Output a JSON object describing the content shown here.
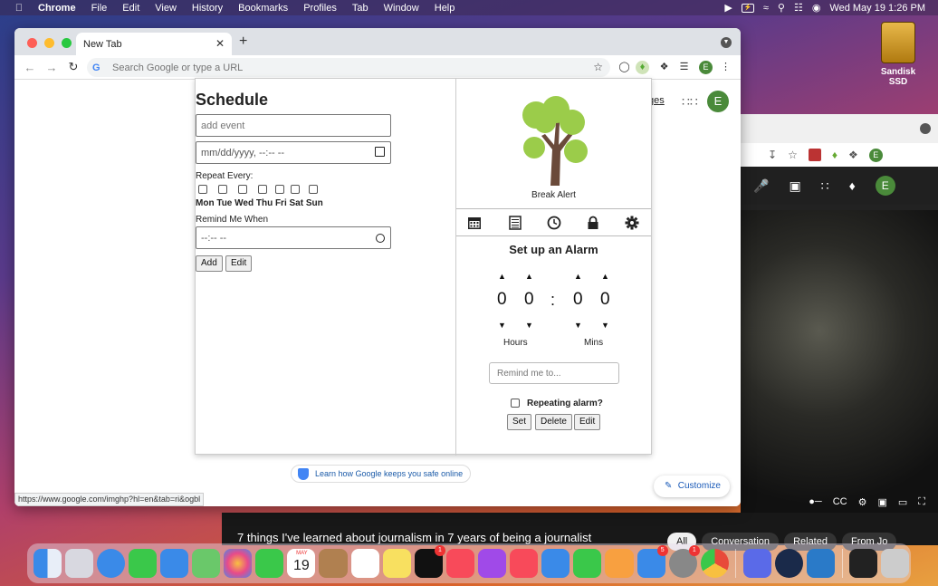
{
  "menubar": {
    "app": "Chrome",
    "items": [
      "File",
      "Edit",
      "View",
      "History",
      "Bookmarks",
      "Profiles",
      "Tab",
      "Window",
      "Help"
    ],
    "datetime": "Wed May 19  1:26 PM"
  },
  "desktop": {
    "drive_label": "Sandisk SSD"
  },
  "chrome": {
    "tab_title": "New Tab",
    "omnibox_placeholder": "Search Google or type a URL",
    "profile_initial": "E",
    "status_url": "https://www.google.com/imghp?hl=en&tab=ri&ogbl",
    "images_link": "ges",
    "safe_link": "Learn how Google keeps you safe online",
    "customize": "Customize"
  },
  "schedule": {
    "title": "Schedule",
    "event_placeholder": "add event",
    "date_placeholder": "mm/dd/yyyy, --:-- --",
    "repeat_label": "Repeat Every:",
    "days": "Mon Tue Wed Thu Fri Sat Sun",
    "remind_label": "Remind Me When",
    "time_placeholder": "--:-- --",
    "add_btn": "Add",
    "edit_btn": "Edit"
  },
  "alarm": {
    "tree_label": "Break Alert",
    "title": "Set up an Alarm",
    "hours_tens": "0",
    "hours_ones": "0",
    "separator": ":",
    "mins_tens": "0",
    "mins_ones": "0",
    "hours_label": "Hours",
    "mins_label": "Mins",
    "remind_placeholder": "Remind me to...",
    "repeating_label": "Repeating alarm?",
    "set_btn": "Set",
    "delete_btn": "Delete",
    "edit_btn": "Edit"
  },
  "youtube": {
    "video_title": "7 things I've learned about journalism in 7 years of being a journalist",
    "chips": [
      "All",
      "Conversation",
      "Related",
      "From Jo"
    ],
    "profile_initial": "E"
  },
  "dock": {
    "calendar_month": "MAY",
    "calendar_day": "19",
    "badges": {
      "tv": "1",
      "appstore": "5",
      "settings": "1"
    }
  }
}
